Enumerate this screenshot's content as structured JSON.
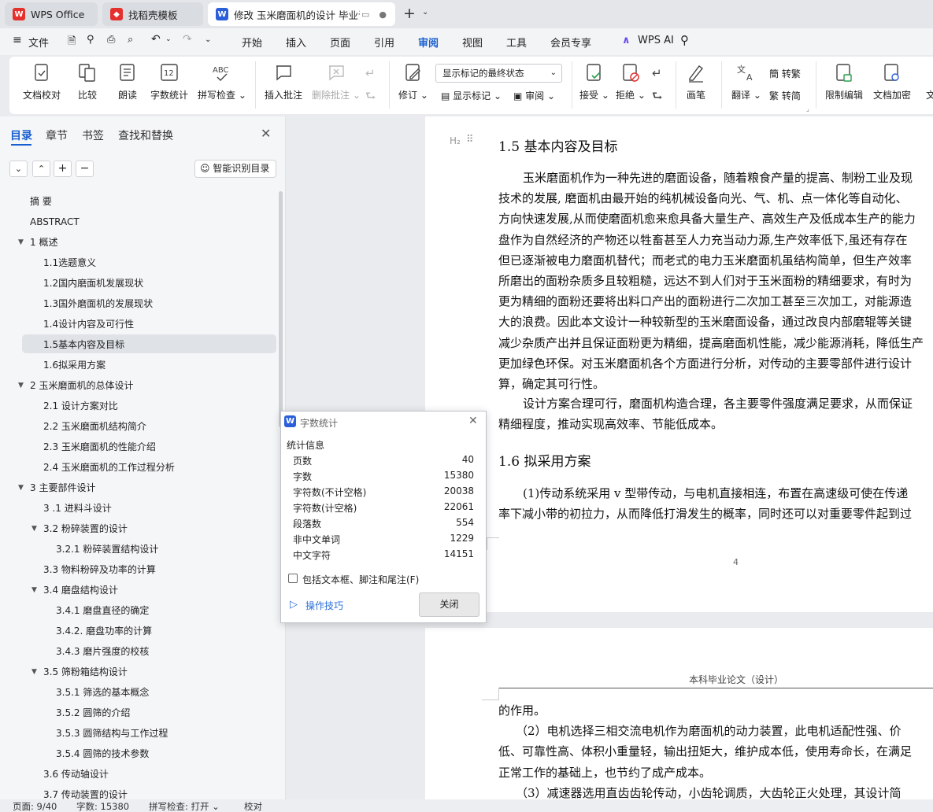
{
  "tabs": [
    {
      "label": "WPS Office",
      "icon": "wps-logo",
      "color": "#e5312e"
    },
    {
      "label": "找稻壳模板",
      "icon": "docer-icon",
      "color": "#e5312e"
    },
    {
      "label": "修改 玉米磨面机的设计 毕业论",
      "icon": "word-doc-icon",
      "color": "#2b5fd9"
    }
  ],
  "menu": {
    "file": "文件",
    "items": [
      "开始",
      "插入",
      "页面",
      "引用",
      "审阅",
      "视图",
      "工具",
      "会员专享"
    ],
    "active": "审阅",
    "ai": "WPS AI"
  },
  "ribbon": {
    "doc_check": "文档校对",
    "compare": "比较",
    "read": "朗读",
    "word_count": "字数统计",
    "spell": "拼写检查",
    "insert_comment": "插入批注",
    "delete_comment": "删除批注",
    "revise": "修订",
    "markup_select": "显示标记的最终状态",
    "show_markup": "显示标记",
    "review": "审阅",
    "accept": "接受",
    "reject": "拒绝",
    "pen": "画笔",
    "translate": "翻译",
    "to_trad": "转繁",
    "to_simp": "转简",
    "restrict_edit": "限制编辑",
    "doc_encrypt": "文档加密",
    "more": "文"
  },
  "sidebar": {
    "tabs": [
      "目录",
      "章节",
      "书签",
      "查找和替换"
    ],
    "smart_btn": "智能识别目录",
    "toc": [
      {
        "label": "摘  要",
        "level": 0
      },
      {
        "label": "ABSTRACT",
        "level": 0
      },
      {
        "label": "1   概述",
        "level": 0,
        "arrow": true
      },
      {
        "label": "1.1选题意义",
        "level": 1
      },
      {
        "label": "1.2国内磨面机发展现状",
        "level": 1
      },
      {
        "label": "1.3国外磨面机的发展现状",
        "level": 1
      },
      {
        "label": "1.4设计内容及可行性",
        "level": 1
      },
      {
        "label": "1.5基本内容及目标",
        "level": 1,
        "selected": true
      },
      {
        "label": "1.6拟采用方案",
        "level": 1
      },
      {
        "label": "2  玉米磨面机的总体设计",
        "level": 0,
        "arrow": true
      },
      {
        "label": "2.1 设计方案对比",
        "level": 1
      },
      {
        "label": "2.2  玉米磨面机结构简介",
        "level": 1
      },
      {
        "label": "2.3 玉米磨面机的性能介绍",
        "level": 1
      },
      {
        "label": "2.4  玉米磨面机的工作过程分析",
        "level": 1
      },
      {
        "label": "3  主要部件设计",
        "level": 0,
        "arrow": true
      },
      {
        "label": "3 .1  进料斗设计",
        "level": 1
      },
      {
        "label": "3.2 粉碎装置的设计",
        "level": 1,
        "arrow": true
      },
      {
        "label": "3.2.1  粉碎装置结构设计",
        "level": 2
      },
      {
        "label": "3.3  物料粉碎及功率的计算",
        "level": 1
      },
      {
        "label": "3.4  磨盘结构设计",
        "level": 1,
        "arrow": true
      },
      {
        "label": "3.4.1  磨盘直径的确定",
        "level": 2
      },
      {
        "label": "3.4.2.  磨盘功率的计算",
        "level": 2
      },
      {
        "label": "3.4.3 磨片强度的校核",
        "level": 2
      },
      {
        "label": "3.5  筛粉箱结构设计",
        "level": 1,
        "arrow": true
      },
      {
        "label": "3.5.1  筛选的基本概念",
        "level": 2
      },
      {
        "label": "3.5.2 圆筛的介绍",
        "level": 2
      },
      {
        "label": "3.5.3  圆筛结构与工作过程",
        "level": 2
      },
      {
        "label": "3.5.4  圆筛的技术参数",
        "level": 2
      },
      {
        "label": "3.6  传动轴设计",
        "level": 1
      },
      {
        "label": "3.7  传动装置的设计",
        "level": 1
      }
    ]
  },
  "doc": {
    "heading_marker": "H₂",
    "h15": "1.5  基本内容及目标",
    "p1": [
      "玉米磨面机作为一种先进的磨面设备，随着粮食产量的提高、制粉工业及现",
      "技术的发展, 磨面机由最开始的纯机械设备向光、气、机、点一体化等自动化、",
      "方向快速发展,从而使磨面机愈来愈具备大量生产、高效生产及低成本生产的能力",
      "盘作为自然经济的产物还以牲畜甚至人力充当动力源,生产效率低下,虽还有存在",
      "但已逐渐被电力磨面机替代；而老式的电力玉米磨面机虽结构简单，但生产效率",
      "所磨出的面粉杂质多且较粗糙，远达不到人们对于玉米面粉的精细要求，有时为",
      "更为精细的面粉还要将出料口产出的面粉进行二次加工甚至三次加工，对能源造",
      "大的浪费。因此本文设计一种较新型的玉米磨面设备，通过改良内部磨辊等关键",
      "减少杂质产出并且保证面粉更为精细，提高磨面机性能，减少能源消耗，降低生产",
      "更加绿色环保。对玉米磨面机各个方面进行分析，对传动的主要零部件进行设计",
      "算，确定其可行性。"
    ],
    "p2": [
      "设计方案合理可行，磨面机构造合理，各主要零件强度满足要求，从而保证",
      "精细程度，推动实现高效率、节能低成本。"
    ],
    "h16": "1.6  拟采用方案",
    "p3": [
      "(1)传动系统采用 v 型带传动，与电机直接相连，布置在高速级可使在传递",
      "率下减小带的初拉力，从而降低打滑发生的概率，同时还可以对重要零件起到过"
    ],
    "page_num": "4",
    "header2": "本科毕业论文（设计）",
    "p4": [
      "的作用。",
      "（2）电机选择三相交流电机作为磨面机的动力装置，此电机适配性强、价",
      "低、可靠性高、体积小重量轻，输出扭矩大，维护成本低，使用寿命长，在满足",
      "正常工作的基础上，也节约了成产成本。",
      "（3）减速器选用直齿齿轮传动，小齿轮调质，大齿轮正火处理，其设计简"
    ]
  },
  "dialog": {
    "title": "字数统计",
    "section": "统计信息",
    "rows": [
      {
        "k": "页数",
        "v": "40"
      },
      {
        "k": "字数",
        "v": "15380"
      },
      {
        "k": "字符数(不计空格)",
        "v": "20038"
      },
      {
        "k": "字符数(计空格)",
        "v": "22061"
      },
      {
        "k": "段落数",
        "v": "554"
      },
      {
        "k": "非中文单词",
        "v": "1229"
      },
      {
        "k": "中文字符",
        "v": "14151"
      }
    ],
    "checkbox": "包括文本框、脚注和尾注(F)",
    "tips": "操作技巧",
    "close": "关闭"
  },
  "status": {
    "page": "页面: 9/40",
    "words": "字数: 15380",
    "spell": "拼写检查: 打开",
    "proof": "校对"
  }
}
